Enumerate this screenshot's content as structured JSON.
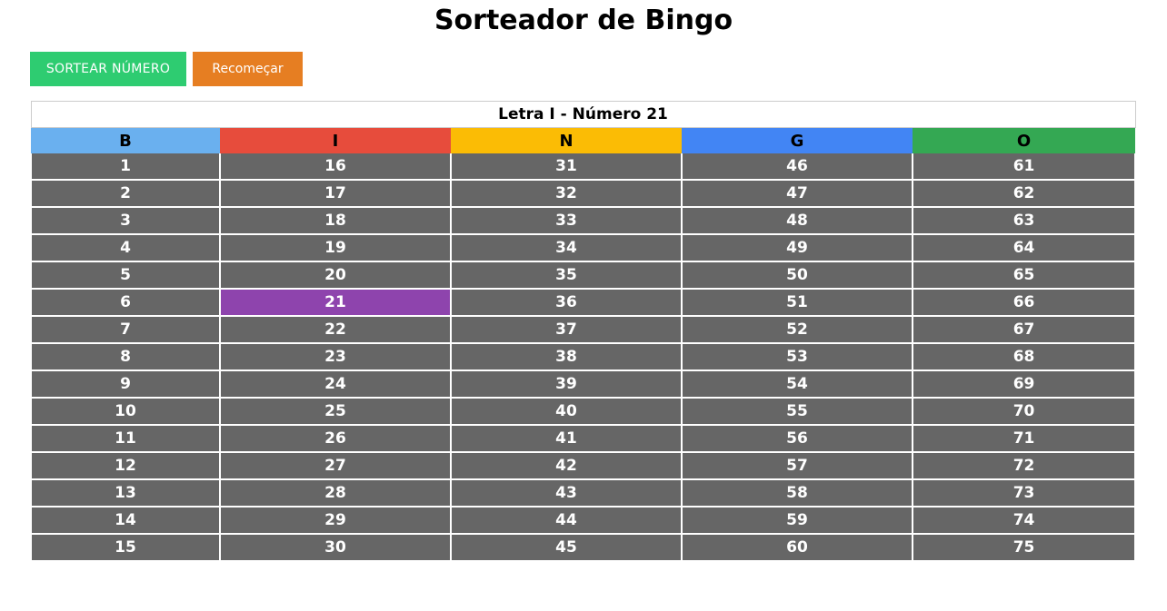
{
  "title": "Sorteador de Bingo",
  "buttons": {
    "draw_label": "SORTEAR NÚMERO",
    "restart_label": "Recomeçar"
  },
  "status": "Letra I - Número 21",
  "drawn_numbers": [
    21
  ],
  "columns": [
    {
      "letter": "B",
      "color": "#6ab0ef",
      "numbers": [
        1,
        2,
        3,
        4,
        5,
        6,
        7,
        8,
        9,
        10,
        11,
        12,
        13,
        14,
        15
      ]
    },
    {
      "letter": "I",
      "color": "#e74c3c",
      "numbers": [
        16,
        17,
        18,
        19,
        20,
        21,
        22,
        23,
        24,
        25,
        26,
        27,
        28,
        29,
        30
      ]
    },
    {
      "letter": "N",
      "color": "#fbbc05",
      "numbers": [
        31,
        32,
        33,
        34,
        35,
        36,
        37,
        38,
        39,
        40,
        41,
        42,
        43,
        44,
        45
      ]
    },
    {
      "letter": "G",
      "color": "#4285f4",
      "numbers": [
        46,
        47,
        48,
        49,
        50,
        51,
        52,
        53,
        54,
        55,
        56,
        57,
        58,
        59,
        60
      ]
    },
    {
      "letter": "O",
      "color": "#34a853",
      "numbers": [
        61,
        62,
        63,
        64,
        65,
        66,
        67,
        68,
        69,
        70,
        71,
        72,
        73,
        74,
        75
      ]
    }
  ],
  "colors": {
    "cell_default": "#666666",
    "cell_drawn": "#8e44ad",
    "draw_button": "#2ecc71",
    "restart_button": "#e67e22"
  }
}
